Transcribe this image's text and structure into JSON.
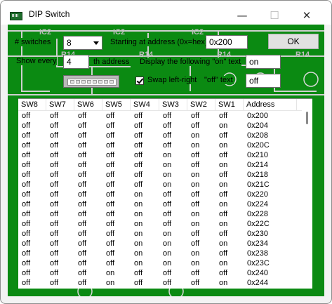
{
  "window": {
    "title": "DIP Switch"
  },
  "titlebar": {
    "min_glyph": "—",
    "max_glyph": "☐",
    "close_glyph": "✕"
  },
  "icons": [
    "dip-switch-app-icon",
    "minimize-icon",
    "maximize-icon",
    "close-icon",
    "chevron-down-icon",
    "checkmark-icon"
  ],
  "form": {
    "switches_label": "# switches",
    "switches_value": "8",
    "address_label": "Starting at address (0x=hex)",
    "address_value": "0x200",
    "ok_label": "OK",
    "every_label": "Show every",
    "every_value": "4",
    "every_suffix": "th address",
    "on_label": "Display the following \"on\" text",
    "on_value": "on",
    "swap_label": "Swap left-right",
    "swap_checked": true,
    "off_label": "\"off\" text",
    "off_value": "off"
  },
  "table": {
    "columns": [
      "SW8",
      "SW7",
      "SW6",
      "SW5",
      "SW4",
      "SW3",
      "SW2",
      "SW1",
      "Address"
    ],
    "rows": [
      [
        "off",
        "off",
        "off",
        "off",
        "off",
        "off",
        "off",
        "off",
        "0x200"
      ],
      [
        "off",
        "off",
        "off",
        "off",
        "off",
        "off",
        "off",
        "on",
        "0x204"
      ],
      [
        "off",
        "off",
        "off",
        "off",
        "off",
        "off",
        "on",
        "off",
        "0x208"
      ],
      [
        "off",
        "off",
        "off",
        "off",
        "off",
        "off",
        "on",
        "on",
        "0x20C"
      ],
      [
        "off",
        "off",
        "off",
        "off",
        "off",
        "on",
        "off",
        "off",
        "0x210"
      ],
      [
        "off",
        "off",
        "off",
        "off",
        "off",
        "on",
        "off",
        "on",
        "0x214"
      ],
      [
        "off",
        "off",
        "off",
        "off",
        "off",
        "on",
        "on",
        "off",
        "0x218"
      ],
      [
        "off",
        "off",
        "off",
        "off",
        "off",
        "on",
        "on",
        "on",
        "0x21C"
      ],
      [
        "off",
        "off",
        "off",
        "off",
        "on",
        "off",
        "off",
        "off",
        "0x220"
      ],
      [
        "off",
        "off",
        "off",
        "off",
        "on",
        "off",
        "off",
        "on",
        "0x224"
      ],
      [
        "off",
        "off",
        "off",
        "off",
        "on",
        "off",
        "on",
        "off",
        "0x228"
      ],
      [
        "off",
        "off",
        "off",
        "off",
        "on",
        "off",
        "on",
        "on",
        "0x22C"
      ],
      [
        "off",
        "off",
        "off",
        "off",
        "on",
        "on",
        "off",
        "off",
        "0x230"
      ],
      [
        "off",
        "off",
        "off",
        "off",
        "on",
        "on",
        "off",
        "on",
        "0x234"
      ],
      [
        "off",
        "off",
        "off",
        "off",
        "on",
        "on",
        "on",
        "off",
        "0x238"
      ],
      [
        "off",
        "off",
        "off",
        "off",
        "on",
        "on",
        "on",
        "on",
        "0x23C"
      ],
      [
        "off",
        "off",
        "off",
        "on",
        "off",
        "off",
        "off",
        "off",
        "0x240"
      ],
      [
        "off",
        "off",
        "off",
        "on",
        "off",
        "off",
        "off",
        "on",
        "0x244"
      ]
    ]
  },
  "pcb_labels": [
    "IC2",
    "IC2",
    "IC2",
    "R14",
    "R14",
    "R14",
    "R14"
  ],
  "colors": {
    "pcb_green": "#0b8a12",
    "trace": "#d8d8d8",
    "pad": "#e8e8e8"
  }
}
